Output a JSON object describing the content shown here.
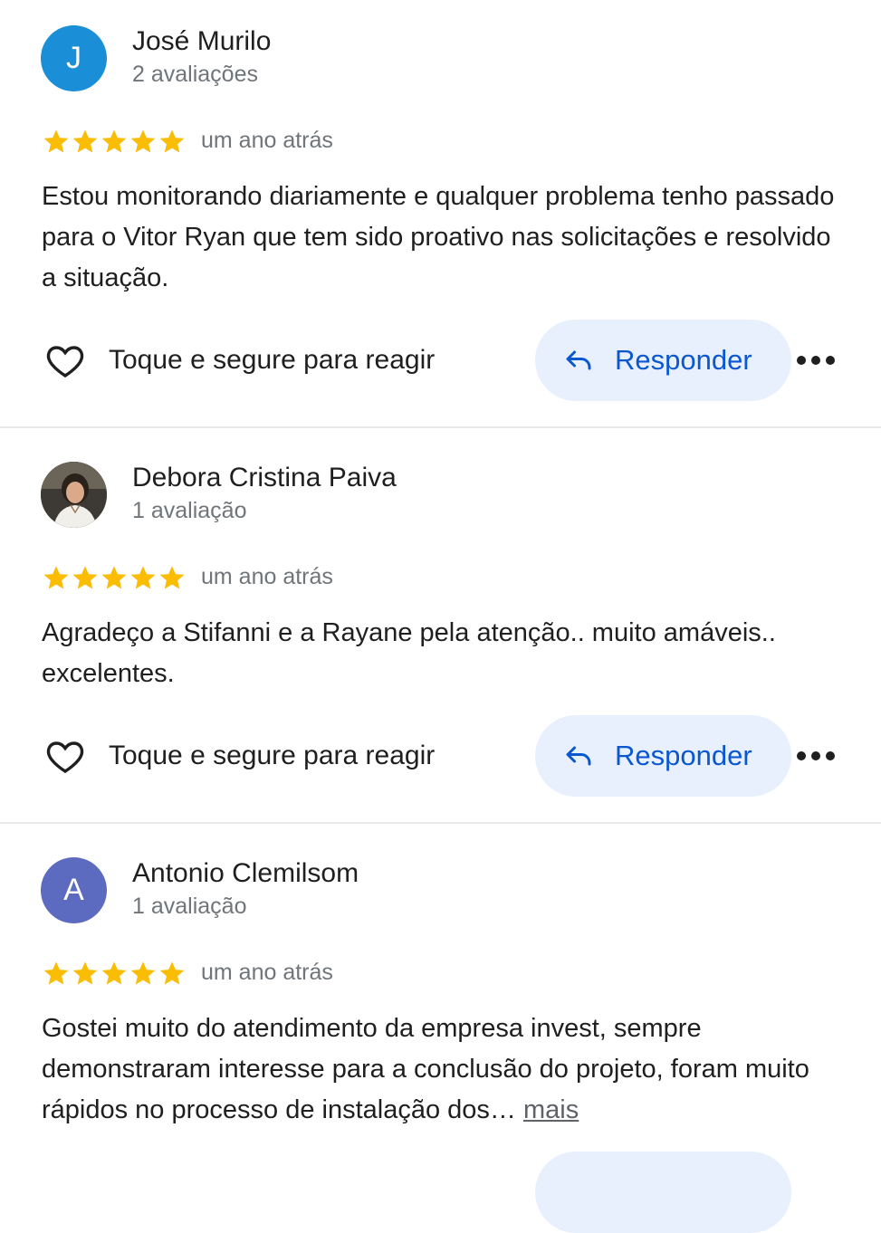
{
  "reviews": [
    {
      "avatar_letter": "J",
      "avatar_color": "#1a8fd8",
      "author": "José Murilo",
      "review_count": "2 avaliações",
      "rating": 5,
      "time": "um ano atrás",
      "text": "Estou monitorando diariamente e qualquer problema tenho passado para o Vitor Ryan que tem sido proativo nas solicitações e resolvido a situação.",
      "react_label": "Toque e segure para reagir",
      "reply_label": "Responder"
    },
    {
      "avatar_letter": "",
      "avatar_color": "#5a4a3c",
      "author": "Debora Cristina Paiva",
      "review_count": "1 avaliação",
      "rating": 5,
      "time": "um ano atrás",
      "text": "Agradeço a Stifanni e a Rayane pela atenção.. muito amáveis.. excelentes.",
      "react_label": "Toque e segure para reagir",
      "reply_label": "Responder"
    },
    {
      "avatar_letter": "A",
      "avatar_color": "#5c6bc0",
      "author": "Antonio Clemilsom",
      "review_count": "1 avaliação",
      "rating": 5,
      "time": "um ano atrás",
      "text": "Gostei muito do atendimento da empresa invest, sempre demonstraram interesse para a conclusão do projeto, foram muito rápidos no processo de instalação dos…",
      "more_label": "mais"
    }
  ],
  "colors": {
    "star": "#fbbc04",
    "reply_bg": "#e8f0fe",
    "reply_text": "#0b57d0",
    "secondary_text": "#70757a"
  }
}
